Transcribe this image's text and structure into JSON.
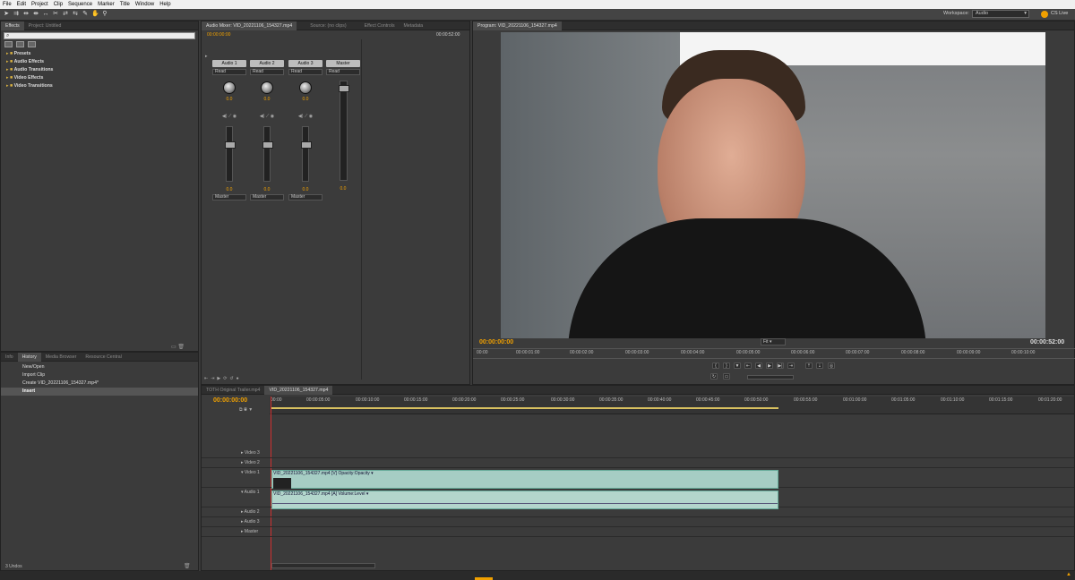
{
  "menu": [
    "File",
    "Edit",
    "Project",
    "Clip",
    "Sequence",
    "Marker",
    "Title",
    "Window",
    "Help"
  ],
  "workspace": {
    "label": "Workspace:",
    "value": "Audio",
    "cslive": "CS Live"
  },
  "left_top": {
    "tabs": [
      "Effects",
      "Project: Untitled"
    ],
    "tree": [
      "Presets",
      "Audio Effects",
      "Audio Transitions",
      "Video Effects",
      "Video Transitions"
    ]
  },
  "left_bottom": {
    "tabs": [
      "Info",
      "History",
      "Media Browser",
      "Resource Central"
    ],
    "items": [
      "New/Open",
      "Import Clip",
      "Create VID_20221106_154327.mp4*",
      "Insert"
    ],
    "footer": "3 Undos"
  },
  "mixer": {
    "tabs": [
      "Audio Mixer: VID_20221106_154327.mp4",
      "Source: (no clips)",
      "Effect Controls",
      "Metadata"
    ],
    "time_left": "00:00:00:00",
    "time_right": "00:00:52:00",
    "channels": [
      {
        "name": "Audio 1",
        "mode": "Read",
        "pan": "0.0",
        "level": "0.0",
        "out": "Master"
      },
      {
        "name": "Audio 2",
        "mode": "Read",
        "pan": "0.0",
        "level": "0.0",
        "out": "Master"
      },
      {
        "name": "Audio 3",
        "mode": "Read",
        "pan": "0.0",
        "level": "0.0",
        "out": "Master"
      },
      {
        "name": "Master",
        "mode": "Read",
        "pan": "",
        "level": "0.0",
        "out": ""
      }
    ]
  },
  "program": {
    "tab": "Program: VID_20221106_154327.mp4",
    "time_left": "00:00:00:00",
    "time_right": "00:00:52:00",
    "fit": "Fit",
    "ruler": [
      "00:00",
      "00:00:01:00",
      "00:00:02:00",
      "00:00:03:00",
      "00:00:04:00",
      "00:00:05:00",
      "00:00:06:00",
      "00:00:07:00",
      "00:00:08:00",
      "00:00:09:00",
      "00:00:10:00"
    ]
  },
  "timeline": {
    "tabs": [
      "TOTH Original Trailer.mp4",
      "VID_20221106_154327.mp4"
    ],
    "time": "00:00:00:00",
    "ruler": [
      "00:00",
      "00:00:05:00",
      "00:00:10:00",
      "00:00:15:00",
      "00:00:20:00",
      "00:00:25:00",
      "00:00:30:00",
      "00:00:35:00",
      "00:00:40:00",
      "00:00:45:00",
      "00:00:50:00",
      "00:00:55:00",
      "00:01:00:00",
      "00:01:05:00",
      "00:01:10:00",
      "00:01:15:00",
      "00:01:20:00"
    ],
    "tracks": [
      "Video 3",
      "Video 2",
      "Video 1",
      "Audio 1",
      "Audio 2",
      "Audio 3",
      "Master"
    ],
    "video_clip": "VID_20221106_154327.mp4 [V] Opacity:Opacity ▾",
    "audio_clip": "VID_20221106_154327.mp4 [A] Volume:Level ▾"
  },
  "colors": {
    "accent": "#f0a000",
    "panel": "#3b3b3b",
    "clip": "#a6cdc4"
  }
}
